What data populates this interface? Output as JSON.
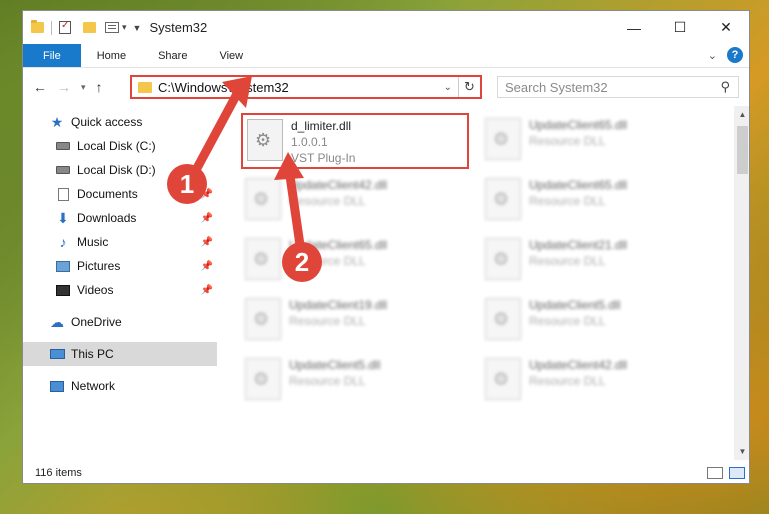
{
  "window": {
    "title": "System32",
    "controls": {
      "minimize": "—",
      "maximize": "☐",
      "close": "✕"
    }
  },
  "ribbon": {
    "tabs": [
      "File",
      "Home",
      "Share",
      "View"
    ]
  },
  "navigation": {
    "address": "C:\\Windows\\System32",
    "search_placeholder": "Search System32"
  },
  "sidebar": {
    "items": [
      {
        "label": "Quick access",
        "icon": "star-icon",
        "pinned": false
      },
      {
        "label": "Local Disk (C:)",
        "icon": "drive-icon",
        "pinned": false
      },
      {
        "label": "Local Disk (D:)",
        "icon": "drive-icon",
        "pinned": false
      },
      {
        "label": "Documents",
        "icon": "documents-icon",
        "pinned": true
      },
      {
        "label": "Downloads",
        "icon": "downloads-icon",
        "pinned": true
      },
      {
        "label": "Music",
        "icon": "music-icon",
        "pinned": true
      },
      {
        "label": "Pictures",
        "icon": "pictures-icon",
        "pinned": true
      },
      {
        "label": "Videos",
        "icon": "videos-icon",
        "pinned": true
      },
      {
        "label": "OneDrive",
        "icon": "onedrive-icon",
        "pinned": false
      },
      {
        "label": "This PC",
        "icon": "this-pc-icon",
        "pinned": false,
        "selected": true
      },
      {
        "label": "Network",
        "icon": "network-icon",
        "pinned": false
      }
    ]
  },
  "files": [
    {
      "name": "d_limiter.dll",
      "line2": "1.0.0.1",
      "line3": "VST Plug-In",
      "highlighted": true
    },
    {
      "name": "UpdateClient65.dll",
      "line2": "Resource DLL"
    },
    {
      "name": "UpdateClient42.dll",
      "line2": "Resource DLL"
    },
    {
      "name": "UpdateClient65.dll",
      "line2": "Resource DLL"
    },
    {
      "name": "UpdateClient65.dll",
      "line2": "Resource DLL"
    },
    {
      "name": "UpdateClient21.dll",
      "line2": "Resource DLL"
    },
    {
      "name": "UpdateClient19.dll",
      "line2": "Resource DLL"
    },
    {
      "name": "UpdateClient5.dll",
      "line2": "Resource DLL"
    },
    {
      "name": "UpdateClient5.dll",
      "line2": "Resource DLL"
    },
    {
      "name": "UpdateClient42.dll",
      "line2": "Resource DLL"
    }
  ],
  "status": {
    "item_count": "116 items"
  },
  "annotations": {
    "badge1": "1",
    "badge2": "2",
    "color": "#e0453a"
  }
}
